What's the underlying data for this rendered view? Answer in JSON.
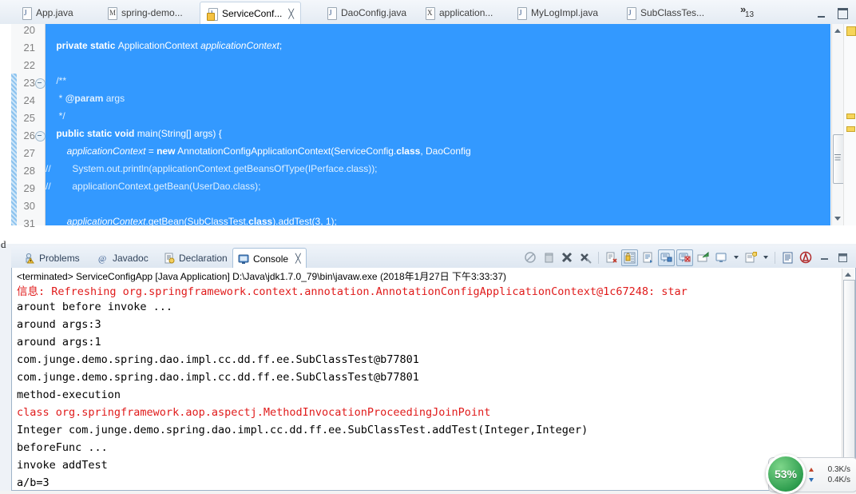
{
  "editor": {
    "tabs": [
      {
        "label": "App.java",
        "icon": "java-file-icon",
        "letter": "J",
        "active": false,
        "warn": false
      },
      {
        "label": "spring-demo...",
        "icon": "maven-file-icon",
        "letter": "M",
        "active": false,
        "warn": false
      },
      {
        "label": "ServiceConf...",
        "icon": "java-file-warning-icon",
        "letter": "J",
        "active": true,
        "warn": true,
        "close": "╳"
      },
      {
        "label": "DaoConfig.java",
        "icon": "java-file-icon",
        "letter": "J",
        "active": false,
        "warn": false
      },
      {
        "label": "application...",
        "icon": "xml-file-icon",
        "letter": "X",
        "active": false,
        "warn": false
      },
      {
        "label": "MyLogImpl.java",
        "icon": "java-file-icon",
        "letter": "J",
        "active": false,
        "warn": false
      },
      {
        "label": "SubClassTes...",
        "icon": "java-file-icon",
        "letter": "J",
        "active": false,
        "warn": false
      }
    ],
    "overflow": {
      "chevron": "»",
      "count": "13"
    },
    "window_controls": {
      "minimize": "minimize-button",
      "maximize": "maximize-button"
    },
    "line_numbers": [
      "20",
      "21",
      "22",
      "23",
      "24",
      "25",
      "26",
      "27",
      "28",
      "29",
      "30",
      "31"
    ],
    "selection_color": "#3399ff",
    "code_lines": [
      {
        "num": "20",
        "text": ""
      },
      {
        "num": "21",
        "text": "    private static ApplicationContext applicationContext;"
      },
      {
        "num": "22",
        "text": ""
      },
      {
        "num": "23",
        "text": "    /**"
      },
      {
        "num": "24",
        "text": "     * @param args"
      },
      {
        "num": "25",
        "text": "     */"
      },
      {
        "num": "26",
        "text": "    public static void main(String[] args) {"
      },
      {
        "num": "27",
        "text": "        applicationContext = new AnnotationConfigApplicationContext(ServiceConfig.class, DaoConfig"
      },
      {
        "num": "28",
        "text": "//        System.out.println(applicationContext.getBeansOfType(IPerface.class));"
      },
      {
        "num": "29",
        "text": "//        applicationContext.getBean(UserDao.class);"
      },
      {
        "num": "30",
        "text": ""
      },
      {
        "num": "31",
        "text": "        applicationContext.getBean(SubClassTest.class).addTest(3, 1);"
      }
    ]
  },
  "console": {
    "view_tabs": [
      {
        "label": "Problems",
        "icon": "problems-icon",
        "active": false
      },
      {
        "label": "Javadoc",
        "icon": "javadoc-icon",
        "active": false
      },
      {
        "label": "Declaration",
        "icon": "declaration-icon",
        "active": false
      },
      {
        "label": "Console",
        "icon": "console-icon",
        "active": true,
        "close": "╳"
      }
    ],
    "toolbar_buttons": [
      "terminate-all-icon",
      "remove-launch-icon",
      "remove-all-terminated-icon",
      "clear-console-icon",
      "separator",
      "open-console-icon",
      "scroll-lock-icon",
      "word-wrap-icon",
      "show-console-on-output-icon",
      "show-console-on-error-icon",
      "pin-console-icon",
      "display-selected-console-icon",
      "display-console-dropdown-icon",
      "open-new-console-icon",
      "new-console-dropdown-icon",
      "separator2",
      "console-preferences-icon",
      "error-log-icon",
      "minimize-view-icon",
      "maximize-view-icon"
    ],
    "header": "<terminated> ServiceConfigApp [Java Application] D:\\Java\\jdk1.7.0_79\\bin\\javaw.exe (2018年1月27日 下午3:33:37)",
    "lines": [
      {
        "text": "信息: Refreshing org.springframework.context.annotation.AnnotationConfigApplicationContext@1c67248: star",
        "error": true
      },
      {
        "text": "arount before invoke ...",
        "error": false
      },
      {
        "text": "around args:3",
        "error": false
      },
      {
        "text": "around args:1",
        "error": false
      },
      {
        "text": "com.junge.demo.spring.dao.impl.cc.dd.ff.ee.SubClassTest@b77801",
        "error": false
      },
      {
        "text": "com.junge.demo.spring.dao.impl.cc.dd.ff.ee.SubClassTest@b77801",
        "error": false
      },
      {
        "text": "method-execution",
        "error": false
      },
      {
        "text": "class org.springframework.aop.aspectj.MethodInvocationProceedingJoinPoint",
        "error": true
      },
      {
        "text": "Integer com.junge.demo.spring.dao.impl.cc.dd.ff.ee.SubClassTest.addTest(Integer,Integer)",
        "error": false
      },
      {
        "text": "beforeFunc ...",
        "error": false
      },
      {
        "text": "invoke addTest",
        "error": false
      },
      {
        "text": "a/b=3",
        "error": false
      }
    ],
    "error_color": "#e01b1b"
  },
  "stray_text": "d",
  "network_widget": {
    "percent": "53%",
    "upload": "0.3K/s",
    "download": "0.4K/s",
    "gauge_color": "#2f9e4f"
  }
}
